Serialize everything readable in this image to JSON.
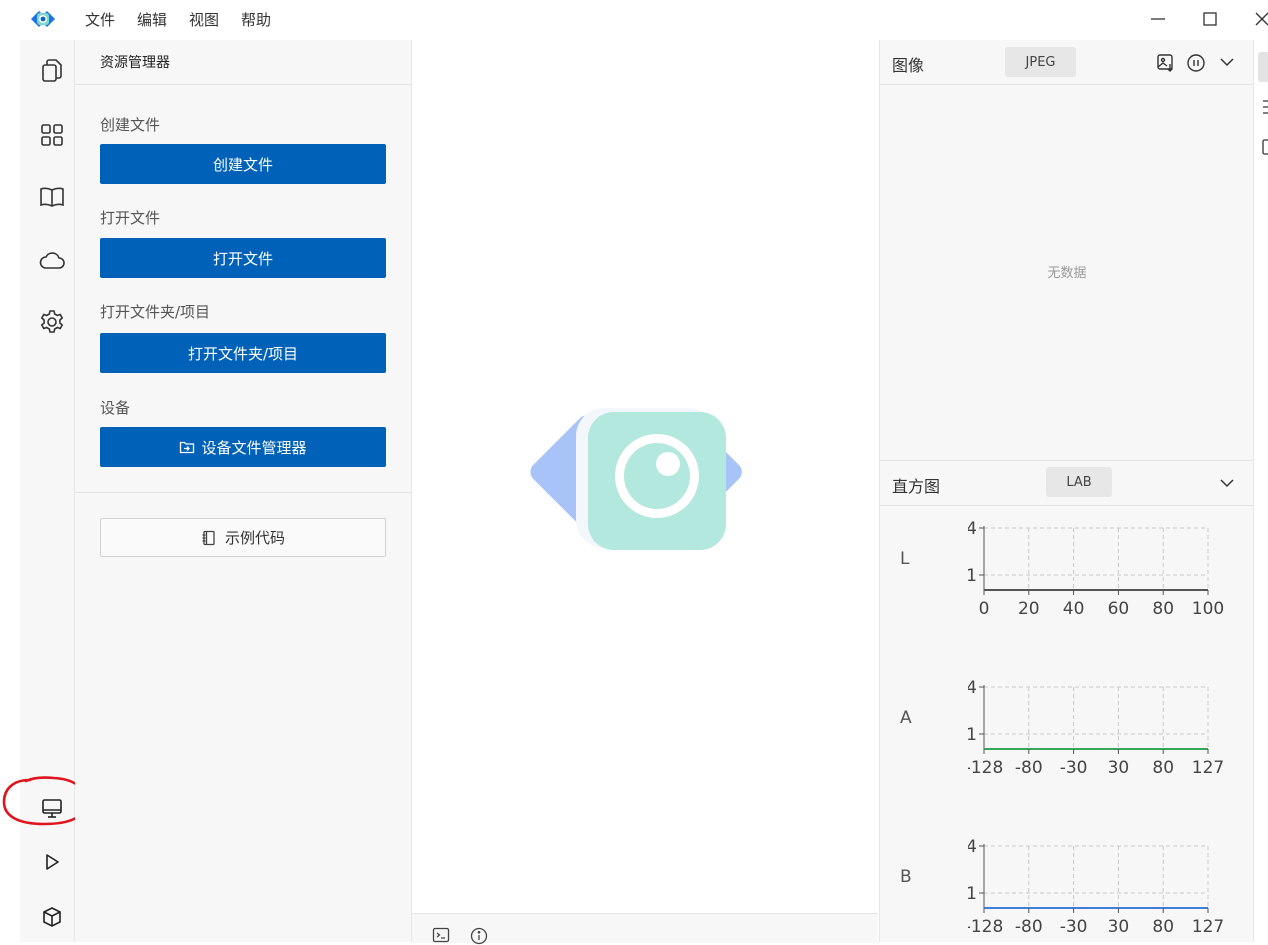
{
  "menu": {
    "items": [
      "文件",
      "编辑",
      "视图",
      "帮助"
    ]
  },
  "window_controls": [
    "minimize-icon",
    "maximize-icon",
    "close-icon"
  ],
  "activity_bar": {
    "top_icons": [
      "files-icon",
      "apps-grid-icon",
      "book-icon",
      "cloud-icon",
      "settings-gear-icon"
    ],
    "bottom_icons": [
      "monitor-icon",
      "play-icon",
      "package-icon"
    ]
  },
  "explorer": {
    "title": "资源管理器",
    "sections": [
      {
        "label": "创建文件",
        "button": "创建文件"
      },
      {
        "label": "打开文件",
        "button": "打开文件"
      },
      {
        "label": "打开文件夹/项目",
        "button": "打开文件夹/项目"
      },
      {
        "label": "设备",
        "button": "设备文件管理器"
      }
    ],
    "sample_code": "示例代码"
  },
  "image_panel": {
    "title": "图像",
    "format": "JPEG",
    "empty_text": "无数据"
  },
  "histogram_panel": {
    "title": "直方图",
    "colorspace": "LAB",
    "channels": [
      {
        "label": "L",
        "x_ticks": [
          "0",
          "20",
          "40",
          "60",
          "80",
          "100"
        ],
        "y_ticks": [
          "4",
          "1"
        ],
        "line_color": "#555555"
      },
      {
        "label": "A",
        "x_ticks": [
          "-128",
          "-80",
          "-30",
          "30",
          "80",
          "127"
        ],
        "y_ticks": [
          "4",
          "1"
        ],
        "line_color": "#3aa55d"
      },
      {
        "label": "B",
        "x_ticks": [
          "-128",
          "-80",
          "-30",
          "30",
          "80",
          "127"
        ],
        "y_ticks": [
          "4",
          "1"
        ],
        "line_color": "#3f7fd6"
      }
    ]
  },
  "colors": {
    "primary_button": "#0061b8",
    "annotation_circle": "#e0141e"
  }
}
